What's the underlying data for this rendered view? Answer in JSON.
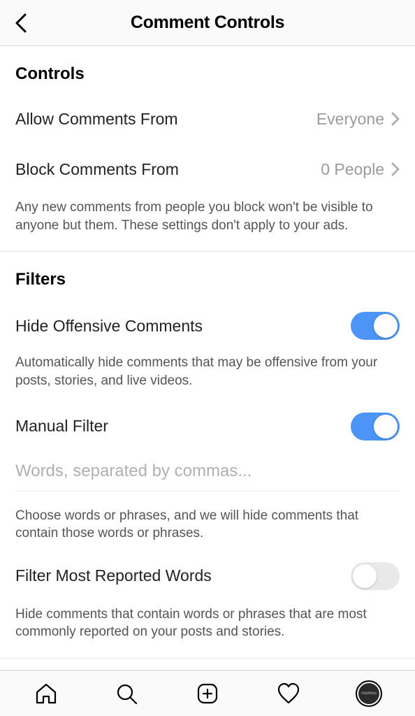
{
  "header": {
    "title": "Comment Controls"
  },
  "controls": {
    "title": "Controls",
    "allow": {
      "label": "Allow Comments From",
      "value": "Everyone"
    },
    "block": {
      "label": "Block Comments From",
      "value": "0 People"
    },
    "desc": "Any new comments from people you block won't be visible to anyone but them. These settings don't apply to your ads."
  },
  "filters": {
    "title": "Filters",
    "hide_offensive": {
      "label": "Hide Offensive Comments",
      "desc": "Automatically hide comments that may be offensive from your posts, stories, and live videos.",
      "on": true
    },
    "manual": {
      "label": "Manual Filter",
      "placeholder": "Words, separated by commas...",
      "desc": "Choose words or phrases, and we will hide comments that contain those words or phrases.",
      "on": true
    },
    "most_reported": {
      "label": "Filter Most Reported Words",
      "desc": "Hide comments that contain words or phrases that are most commonly reported on your posts and stories.",
      "on": false
    }
  },
  "nav": {
    "profile_label": "roomvu"
  }
}
